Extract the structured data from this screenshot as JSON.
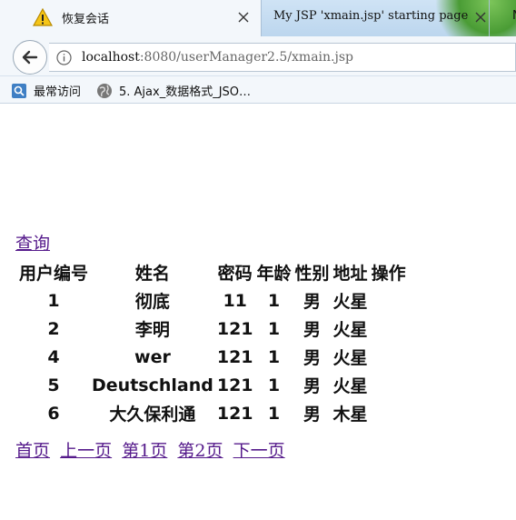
{
  "browser": {
    "tabs": [
      {
        "title": "恢复会话",
        "active": true
      },
      {
        "title": "My JSP 'xmain.jsp' starting page",
        "active": false
      },
      {
        "title": "N",
        "active": false
      }
    ],
    "url_host": "localhost",
    "url_rest": ":8080/userManager2.5/xmain.jsp",
    "bookmarks": [
      {
        "label": "最常访问",
        "icon": "most-visited-icon"
      },
      {
        "label": "5. Ajax_数据格式_JSO…",
        "icon": "globe-icon"
      }
    ]
  },
  "page": {
    "query_link": "查询",
    "table": {
      "headers": [
        "用户编号",
        "姓名",
        "密码",
        "年龄",
        "性别",
        "地址",
        "操作"
      ],
      "rows": [
        [
          "1",
          "彻底",
          "11",
          "1",
          "男",
          "火星",
          ""
        ],
        [
          "2",
          "李明",
          "121",
          "1",
          "男",
          "火星",
          ""
        ],
        [
          "4",
          "wer",
          "121",
          "1",
          "男",
          "火星",
          ""
        ],
        [
          "5",
          "Deutschland",
          "121",
          "1",
          "男",
          "火星",
          ""
        ],
        [
          "6",
          "大久保利通",
          "121",
          "1",
          "男",
          "木星",
          ""
        ]
      ]
    },
    "pager": [
      "首页",
      "上一页",
      "第1页",
      "第2页",
      "下一页"
    ]
  },
  "colors": {
    "visited_link": "#551a8b",
    "tab_bar": "#c6dcf2",
    "warning": "#f5c518"
  }
}
